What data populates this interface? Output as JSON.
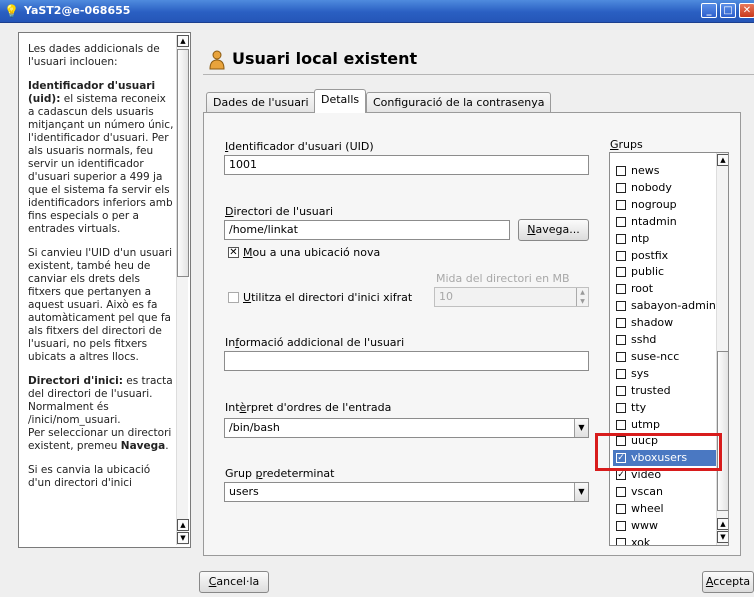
{
  "window": {
    "title": "YaST2@e-068655",
    "icon": "bulb-icon",
    "controls": [
      "minimize-icon",
      "maximize-icon",
      "close-icon"
    ]
  },
  "help": {
    "intro": "Les dades addicionals de l'usuari inclouen:",
    "uid_title": "Identificador d'usuari (uid):",
    "uid_text": " el sistema reconeix a cadascun dels usuaris mitjançant un número únic, l'identificador d'usuari. Per als usuaris normals, feu servir un identificador d'usuari superior a 499 ja que el sistema fa servir els identificadors inferiors amb fins especials o per a entrades virtuals.",
    "uid_change": "Si canvieu l'UID d'un usuari existent, també heu de canviar els drets dels fitxers que pertanyen a aquest usuari. Això es fa automàticament pel que fa als fitxers del directori de l'usuari, no pels fitxers ubicats a altres llocs.",
    "home_title": "Directori d'inici:",
    "home_text": " es tracta del directori de l'usuari. Normalment és /inici/nom_usuari.",
    "home_browse_prefix": "Per seleccionar un directori existent, premeu ",
    "home_browse_bold": "Navega",
    "home_browse_suffix": ".",
    "home_change": "Si es canvia la ubicació d'un directori d'inici"
  },
  "header": {
    "title": "Usuari local existent",
    "icon": "user-icon"
  },
  "tabs": [
    {
      "label": "Dades de l'usuari",
      "active": false
    },
    {
      "label": "Detalls",
      "active": true
    },
    {
      "label": "Configuració de la contrasenya",
      "active": false
    }
  ],
  "form": {
    "uid_label_u": "I",
    "uid_label_rest": "dentificador d'usuari (UID)",
    "uid_value": "1001",
    "home_label_u": "D",
    "home_label_rest": "irectori de l'usuari",
    "home_value": "/home/linkat",
    "browse_label_u": "N",
    "browse_label_rest": "avega...",
    "move_label_u": "M",
    "move_label_rest": "ou a una ubicació nova",
    "move_checked": true,
    "size_label": "Mida del directori en MB",
    "size_value": "10",
    "encrypt_label_u": "U",
    "encrypt_label_rest": "tilitza el directori d'inici xifrat",
    "encrypt_checked": false,
    "info_label_pre": "In",
    "info_label_u": "f",
    "info_label_rest": "ormació addicional de l'usuari",
    "info_value": "",
    "shell_label_pre": "Int",
    "shell_label_u": "è",
    "shell_label_rest": "rpret d'ordres de l'entrada",
    "shell_value": "/bin/bash",
    "group_label_pre": "Grup ",
    "group_label_u": "p",
    "group_label_rest": "redeterminat",
    "group_value": "users"
  },
  "groups": {
    "label_u": "G",
    "label_rest": "rups",
    "items": [
      {
        "name": "news",
        "checked": false
      },
      {
        "name": "nobody",
        "checked": false
      },
      {
        "name": "nogroup",
        "checked": false
      },
      {
        "name": "ntadmin",
        "checked": false
      },
      {
        "name": "ntp",
        "checked": false
      },
      {
        "name": "postfix",
        "checked": false
      },
      {
        "name": "public",
        "checked": false
      },
      {
        "name": "root",
        "checked": false
      },
      {
        "name": "sabayon-admin",
        "checked": false
      },
      {
        "name": "shadow",
        "checked": false
      },
      {
        "name": "sshd",
        "checked": false
      },
      {
        "name": "suse-ncc",
        "checked": false
      },
      {
        "name": "sys",
        "checked": false
      },
      {
        "name": "trusted",
        "checked": false
      },
      {
        "name": "tty",
        "checked": false
      },
      {
        "name": "utmp",
        "checked": false
      },
      {
        "name": "uucp",
        "checked": false
      },
      {
        "name": "vboxusers",
        "checked": true,
        "selected": true
      },
      {
        "name": "video",
        "checked": true
      },
      {
        "name": "vscan",
        "checked": false
      },
      {
        "name": "wheel",
        "checked": false
      },
      {
        "name": "www",
        "checked": false
      },
      {
        "name": "xok",
        "checked": false
      }
    ]
  },
  "footer": {
    "cancel_pre": "",
    "cancel_u": "C",
    "cancel_rest": "ancel·la",
    "accept_u": "A",
    "accept_rest": "ccepta"
  },
  "colors": {
    "highlight": "#d81c1c",
    "selection": "#4a78c2",
    "titlebar": "#2a5fc2"
  }
}
